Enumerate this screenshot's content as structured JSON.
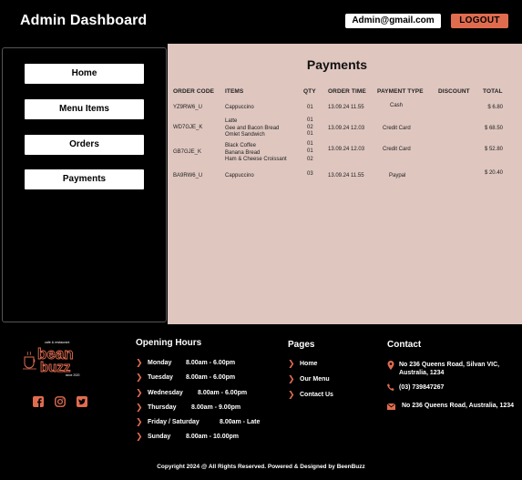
{
  "header": {
    "title": "Admin Dashboard",
    "email": "Admin@gmail.com",
    "logout_label": "LOGOUT"
  },
  "sidebar": {
    "items": [
      {
        "label": "Home"
      },
      {
        "label": "Menu Items"
      },
      {
        "label": "Orders"
      },
      {
        "label": "Payments"
      }
    ]
  },
  "main": {
    "heading": "Payments",
    "columns": [
      "ORDER CODE",
      "ITEMS",
      "QTY",
      "ORDER TIME",
      "PAYMENT TYPE",
      "DISCOUNT",
      "TOTAL"
    ],
    "rows": [
      {
        "code": "YZ9RW6_U",
        "items": [
          "Cappuccino"
        ],
        "qty": [
          "01"
        ],
        "time": "13.09.24 11.55",
        "payment": "Cash",
        "discount": "",
        "total": "$ 6.80"
      },
      {
        "code": "WD7GJE_K",
        "items": [
          "Latte",
          "Gee and Bacon Bread",
          "Omlet Sandwich"
        ],
        "qty": [
          "01",
          "02",
          "01"
        ],
        "time": "13.09.24 12.03",
        "payment": "Credit Card",
        "discount": "",
        "total": "$ 68.50"
      },
      {
        "code": "GB7GJE_K",
        "items": [
          "Black Coffee",
          "Banana Bread",
          "Ham & Cheese Croissant"
        ],
        "qty": [
          "01",
          "01",
          "02"
        ],
        "time": "13.09.24 12.03",
        "payment": "Credit Card",
        "discount": "",
        "total": "$ 52.80"
      },
      {
        "code": "BA9RW6_U",
        "items": [
          "Cappuccino"
        ],
        "qty": [
          "03"
        ],
        "time": "13.09.24 11.55",
        "payment": "Paypal",
        "discount": "",
        "total": "$ 20.40"
      }
    ]
  },
  "footer": {
    "logo": {
      "tagline": "cafe & restaurant",
      "name_top": "bean",
      "name_bottom": "buzz",
      "since": "since 2020"
    },
    "social": [
      "facebook-icon",
      "instagram-icon",
      "twitter-icon"
    ],
    "hours_title": "Opening Hours",
    "hours": [
      {
        "day": "Monday",
        "time": "8.00am  -  6.00pm"
      },
      {
        "day": "Tuesday",
        "time": "8.00am  -  6.00pm"
      },
      {
        "day": "Wednesday",
        "time": "8.00am  -  6.00pm"
      },
      {
        "day": "Thursday",
        "time": "8.00am  -  9.00pm"
      },
      {
        "day": "Friday  /   Saturday",
        "time": "8.00am  -  Late"
      },
      {
        "day": "Sunday",
        "time": "8.00am  -  10.00pm"
      }
    ],
    "pages_title": "Pages",
    "pages": [
      "Home",
      "Our Menu",
      "Contact Us"
    ],
    "contact_title": "Contact",
    "contact": [
      {
        "icon": "location-pin-icon",
        "text": "No 236 Queens Road, Silvan VIC, Australia, 1234"
      },
      {
        "icon": "phone-icon",
        "text": "(03) 739847267"
      },
      {
        "icon": "mail-icon",
        "text": "No 236 Queens Road,  Australia, 1234"
      }
    ],
    "copyright": "Copyright 2024 @ All Rights Reserved. Powered & Designed by BeenBuzz"
  },
  "colors": {
    "accent": "#e06c4f",
    "panel": "#dfc6bf",
    "background": "#000000"
  }
}
